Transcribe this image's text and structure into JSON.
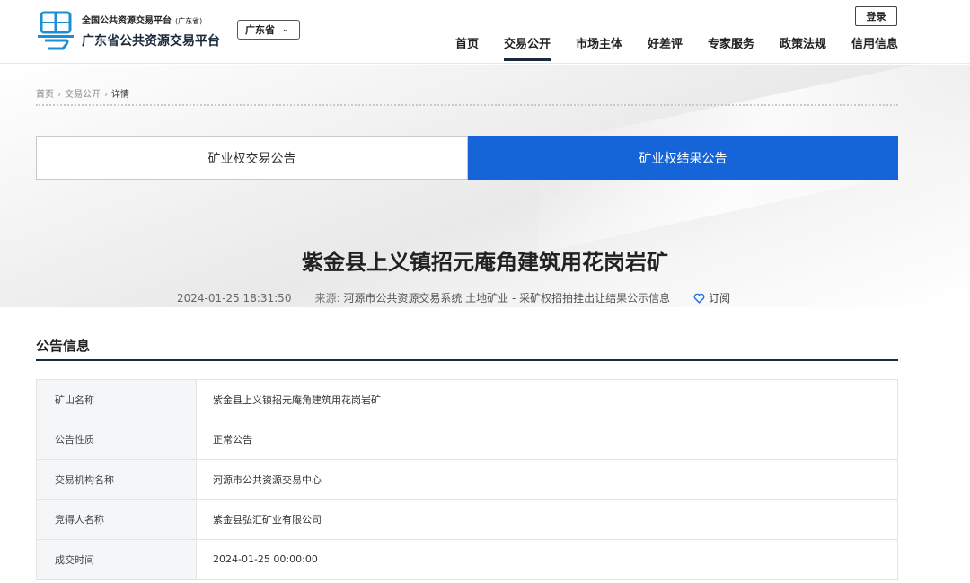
{
  "header": {
    "logo_line1": "全国公共资源交易平台",
    "logo_line1_sub": "(广东省)",
    "logo_line2": "广东省公共资源交易平台",
    "region_select": "广东省",
    "login_label": "登录",
    "nav": [
      {
        "label": "首页",
        "active": false
      },
      {
        "label": "交易公开",
        "active": true
      },
      {
        "label": "市场主体",
        "active": false
      },
      {
        "label": "好差评",
        "active": false
      },
      {
        "label": "专家服务",
        "active": false
      },
      {
        "label": "政策法规",
        "active": false
      },
      {
        "label": "信用信息",
        "active": false
      }
    ]
  },
  "breadcrumb": {
    "home": "首页",
    "section": "交易公开",
    "current": "详情"
  },
  "tabs": [
    {
      "label": "矿业权交易公告",
      "active": false
    },
    {
      "label": "矿业权结果公告",
      "active": true
    }
  ],
  "article": {
    "title": "紫金县上义镇招元庵角建筑用花岗岩矿",
    "datetime": "2024-01-25 18:31:50",
    "source_label": "来源:",
    "source_value": "河源市公共资源交易系统 土地矿业 - 采矿权招拍挂出让结果公示信息",
    "subscribe_label": "订阅"
  },
  "section": {
    "title": "公告信息"
  },
  "info_rows": [
    {
      "key": "矿山名称",
      "value": "紫金县上义镇招元庵角建筑用花岗岩矿"
    },
    {
      "key": "公告性质",
      "value": "正常公告"
    },
    {
      "key": "交易机构名称",
      "value": "河源市公共资源交易中心"
    },
    {
      "key": "竞得人名称",
      "value": "紫金县弘汇矿业有限公司"
    },
    {
      "key": "成交时间",
      "value": "2024-01-25 00:00:00"
    }
  ],
  "colors": {
    "accent": "#1565d8",
    "brand_logo": "#1a8fd6",
    "dark": "#1a2a3a"
  }
}
